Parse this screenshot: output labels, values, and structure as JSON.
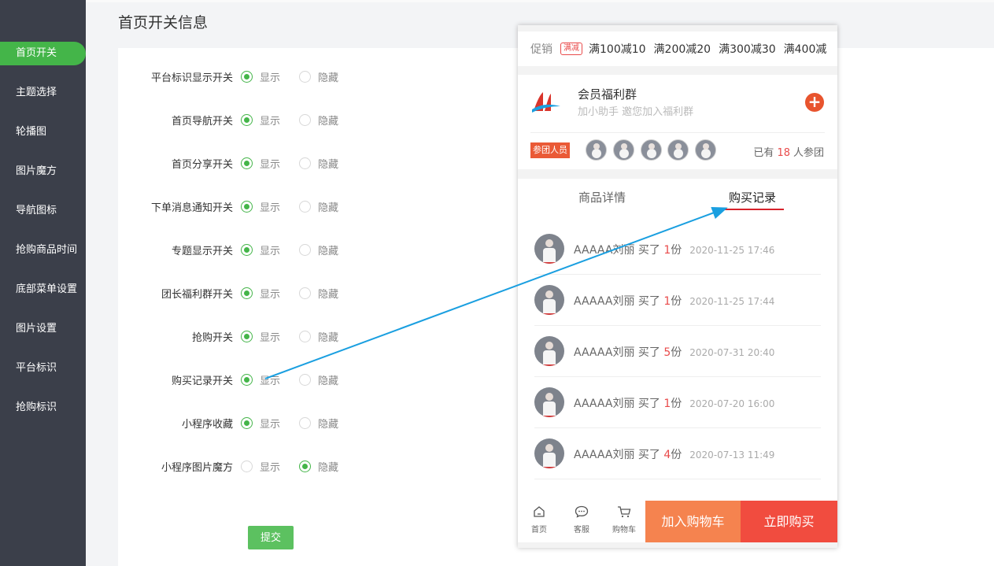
{
  "page": {
    "title": "首页开关信息"
  },
  "sidebar": {
    "items": [
      {
        "label": "首页开关",
        "active": true
      },
      {
        "label": "主题选择"
      },
      {
        "label": "轮播图"
      },
      {
        "label": "图片魔方"
      },
      {
        "label": "导航图标"
      },
      {
        "label": "抢购商品时间"
      },
      {
        "label": "底部菜单设置"
      },
      {
        "label": "图片设置"
      },
      {
        "label": "平台标识"
      },
      {
        "label": "抢购标识"
      }
    ]
  },
  "form": {
    "show_label": "显示",
    "hide_label": "隐藏",
    "rows": [
      {
        "label": "平台标识显示开关",
        "value": "show"
      },
      {
        "label": "首页导航开关",
        "value": "show"
      },
      {
        "label": "首页分享开关",
        "value": "show"
      },
      {
        "label": "下单消息通知开关",
        "value": "show"
      },
      {
        "label": "专题显示开关",
        "value": "show"
      },
      {
        "label": "团长福利群开关",
        "value": "show"
      },
      {
        "label": "抢购开关",
        "value": "show"
      },
      {
        "label": "购买记录开关",
        "value": "show"
      },
      {
        "label": "小程序收藏",
        "value": "show"
      },
      {
        "label": "小程序图片魔方",
        "value": "hide"
      }
    ],
    "submit_label": "提交"
  },
  "preview": {
    "promo": {
      "label": "促销",
      "tag": "满减",
      "items": [
        "满100减10",
        "满200减20",
        "满300减30",
        "满400减"
      ]
    },
    "group": {
      "name": "会员福利群",
      "subtitle": "加小助手 邀您加入福利群",
      "plus": "+",
      "join_tag": "参团人员",
      "joined_prefix": "已有",
      "joined_count": "18",
      "joined_suffix": "人参团"
    },
    "tabs": [
      {
        "label": "商品详情",
        "active": false
      },
      {
        "label": "购买记录",
        "active": true
      }
    ],
    "records": [
      {
        "name": "AAAAA刘丽",
        "bought": "买了",
        "qty": "1",
        "unit": "份",
        "time": "2020-11-25 17:46"
      },
      {
        "name": "AAAAA刘丽",
        "bought": "买了",
        "qty": "1",
        "unit": "份",
        "time": "2020-11-25 17:44"
      },
      {
        "name": "AAAAA刘丽",
        "bought": "买了",
        "qty": "5",
        "unit": "份",
        "time": "2020-07-31 20:40"
      },
      {
        "name": "AAAAA刘丽",
        "bought": "买了",
        "qty": "1",
        "unit": "份",
        "time": "2020-07-20 16:00"
      },
      {
        "name": "AAAAA刘丽",
        "bought": "买了",
        "qty": "4",
        "unit": "份",
        "time": "2020-07-13 11:49"
      }
    ],
    "bottom_bar": {
      "home": "首页",
      "service": "客服",
      "cart": "购物车",
      "add_cart": "加入购物车",
      "buy_now": "立即购买"
    }
  },
  "colors": {
    "accent": "#44b549",
    "sidebar_bg": "#3b3f4a",
    "price_red": "#e94b4b",
    "add_cart_bg": "#f5834f",
    "buy_now_bg": "#f14c3f",
    "arrow": "#1a9fe0"
  }
}
